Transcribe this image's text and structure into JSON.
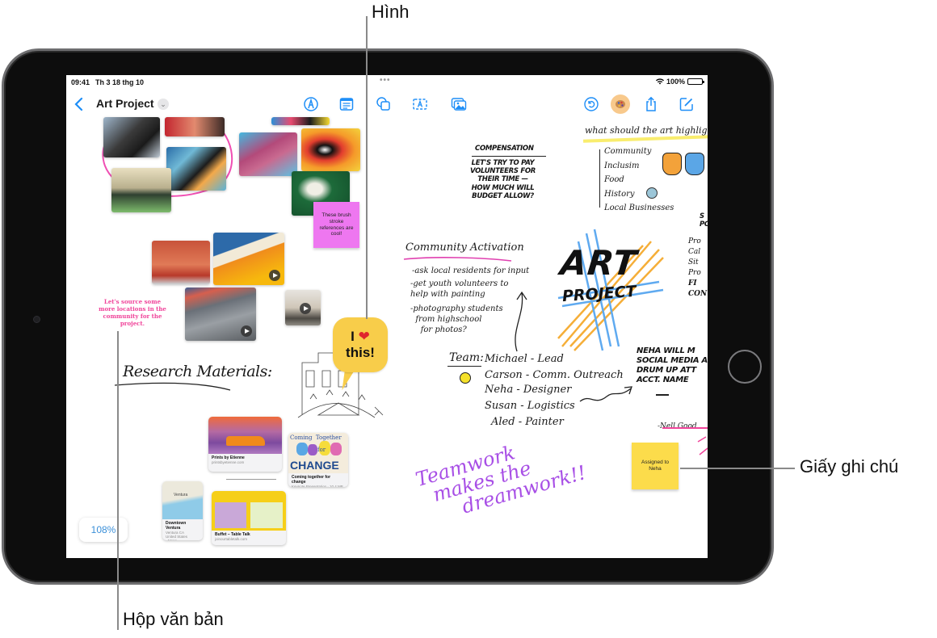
{
  "status_bar": {
    "time": "09:41",
    "date": "Th 3 18 thg 10",
    "battery": "100%"
  },
  "toolbar": {
    "title": "Art Project",
    "buttons": {
      "back": "back-icon",
      "chevron": "chevron-down-icon",
      "pen": "pen-tip-icon",
      "document": "document-icon",
      "shapes": "shapes-icon",
      "text_box": "text-box-icon",
      "media": "photo-library-icon",
      "undo": "undo-icon",
      "collaboration": "palette-icon",
      "share": "share-icon",
      "new_board": "compose-icon"
    }
  },
  "board": {
    "sticky_pink": "These brush stroke references are cool!",
    "sticky_yellow": "Assigned to Neha",
    "pink_text": "Let's source some more locations in the community for the project.",
    "research_heading": "Research Materials:",
    "bubble": {
      "line1": "I",
      "heart": "❤",
      "line2": "this!"
    },
    "compensation": {
      "title": "COMPENSATION",
      "body": "LET'S TRY TO PAY\nVOLUNTEERS FOR\nTHEIR TIME —\nHOW MUCH WILL\nBUDGET ALLOW?"
    },
    "highlight": {
      "title": "what should the art highlight",
      "items": [
        "Community",
        "Inclusim",
        "Food",
        "History",
        "Local Businesses"
      ]
    },
    "community_activation": {
      "title": "Community Activation",
      "items": [
        "-ask local residents for input",
        "-get youth volunteers to\nhelp with painting",
        "-photography students\n  from highschool\n    for photos?"
      ]
    },
    "art_project": {
      "line1": "ART",
      "line2": "PROJECT"
    },
    "team": {
      "title": "Team:",
      "members": [
        "Michael - Lead",
        "Carson - Comm. Outreach",
        "Neha - Designer",
        "Susan - Logistics",
        "Aled - Painter"
      ]
    },
    "neha_note": "NEHA WILL M\nSOCIAL MEDIA A\nDRUM UP ATT\nACCT. NAME",
    "right_edge_list": [
      "Pro",
      "Cal",
      "Sit",
      "Pro",
      "FI",
      "CON"
    ],
    "right_edge_head": "S\nPC",
    "crossed": "-Nell Good",
    "teamwork": "Teamwork\n  makes the\n      dreamwork!!",
    "link_cards": [
      {
        "title": "Prints by Etienne",
        "subtitle": "printsbyetienne.com"
      },
      {
        "title": "Coming together for change",
        "subtitle": "Keynote Presentation · 10.4 MB",
        "art_top": "Coming  Together",
        "art_mid": "for",
        "art_big": "CHANGE"
      },
      {
        "title": "Downtown Ventura",
        "subtitle": "Ventura CA\nUnited States",
        "source": "Maps",
        "map_label": "Ventura"
      },
      {
        "title": "Buffet – Table Talk",
        "subtitle": "joinourtabletalk.com"
      }
    ]
  },
  "zoom_level": "108%",
  "callouts": {
    "shape": "Hình",
    "sticky_note": "Giấy ghi chú",
    "text_box": "Hộp văn bản"
  }
}
